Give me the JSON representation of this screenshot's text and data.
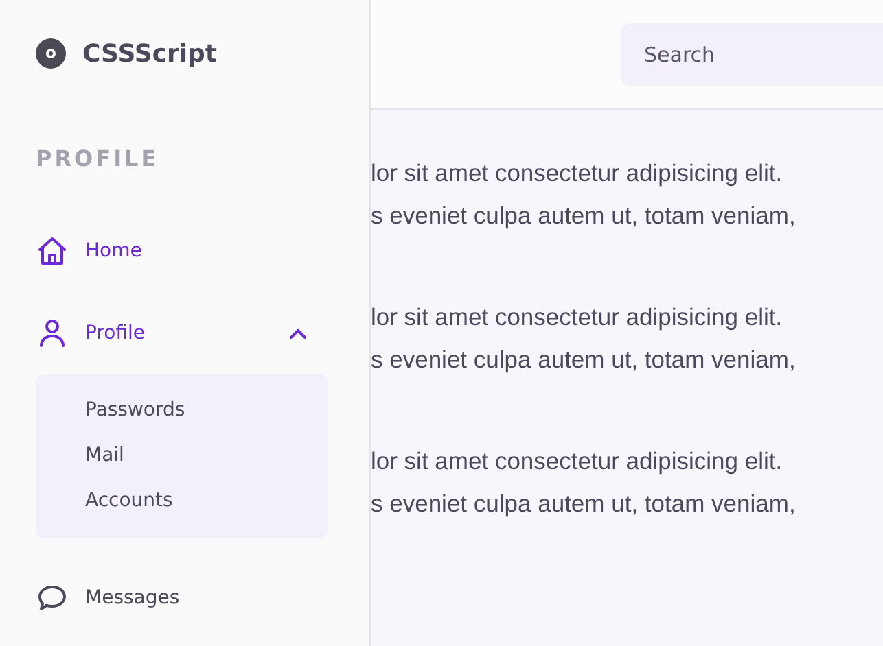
{
  "brand": {
    "name": "CSSScript"
  },
  "sidebar": {
    "section_label": "PROFILE",
    "items": [
      {
        "kind": "home",
        "label": "Home",
        "active": true
      },
      {
        "kind": "user",
        "label": "Profile",
        "active": true,
        "expanded": true,
        "children": [
          {
            "label": "Passwords"
          },
          {
            "label": "Mail"
          },
          {
            "label": "Accounts"
          }
        ]
      },
      {
        "kind": "chat",
        "label": "Messages",
        "active": false
      }
    ]
  },
  "search": {
    "placeholder": "Search"
  },
  "paragraphs": [
    {
      "lines": [
        "lor sit amet consectetur adipisicing elit.",
        "s eveniet culpa autem ut, totam veniam,"
      ]
    },
    {
      "lines": [
        "lor sit amet consectetur adipisicing elit.",
        "s eveniet culpa autem ut, totam veniam,"
      ]
    },
    {
      "lines": [
        "lor sit amet consectetur adipisicing elit.",
        "s eveniet culpa autem ut, totam veniam,"
      ]
    }
  ]
}
